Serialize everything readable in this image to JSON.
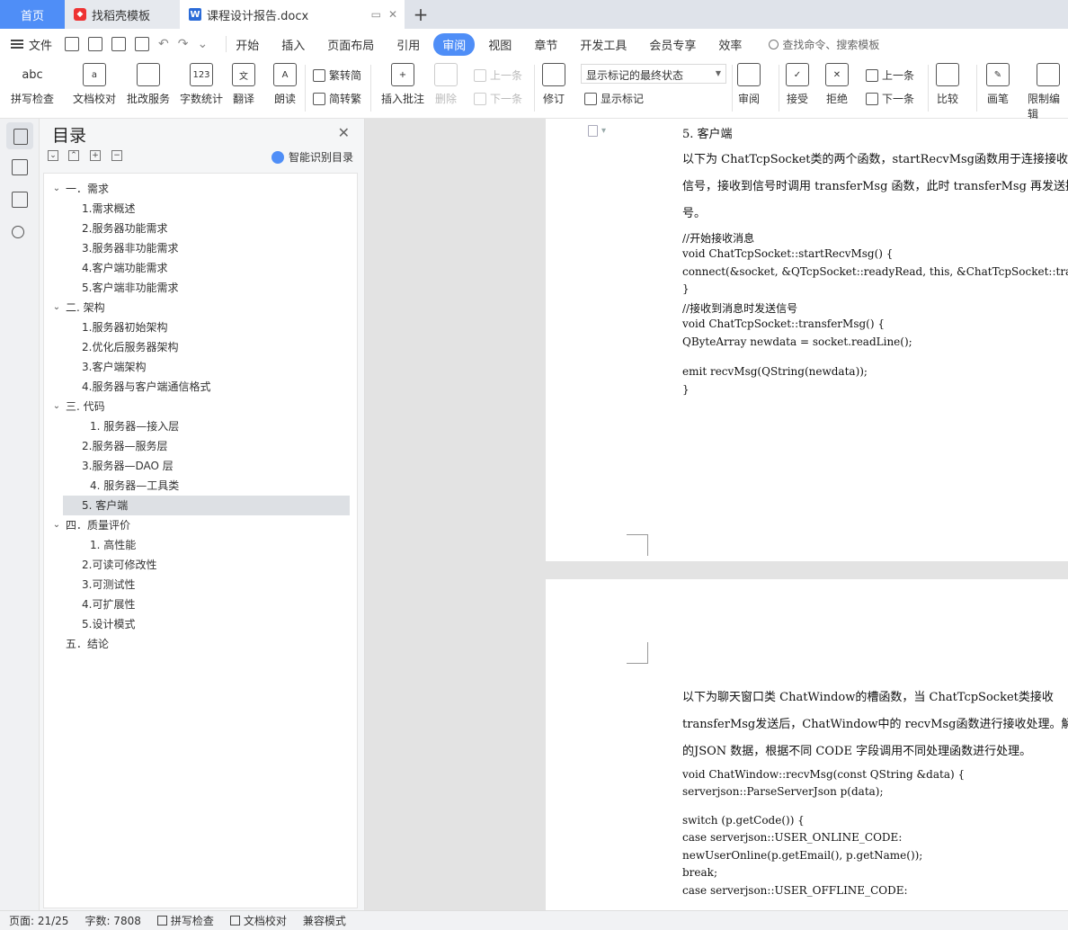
{
  "tabs": {
    "home": "首页",
    "template_tab": "找稻壳模板",
    "doc_tab": "课程设计报告.docx"
  },
  "menubar": {
    "file": "文件",
    "tabs": [
      "开始",
      "插入",
      "页面布局",
      "引用",
      "审阅",
      "视图",
      "章节",
      "开发工具",
      "会员专享",
      "效率"
    ],
    "active_tab": "审阅",
    "search_placeholder": "查找命令、搜索模板"
  },
  "ribbon": {
    "spell_check": "拼写检查",
    "doc_proof": "文档校对",
    "batch_service": "批改服务",
    "word_count": "字数统计",
    "translate": "翻译",
    "read_aloud": "朗读",
    "to_traditional": "繁转简",
    "to_simplified": "简转繁",
    "insert_comment": "插入批注",
    "delete": "删除",
    "prev": "上一条",
    "next": "下一条",
    "track_changes": "修订",
    "display_state": "显示标记的最终状态",
    "show_markup": "显示标记",
    "review": "审阅",
    "accept": "接受",
    "reject": "拒绝",
    "prev2": "上一条",
    "next2": "下一条",
    "compare": "比较",
    "pen": "画笔",
    "restrict_edit": "限制编辑"
  },
  "toc": {
    "title": "目录",
    "smart_label": "智能识别目录",
    "items": [
      {
        "text": "一．需求",
        "level": 1,
        "expanded": true
      },
      {
        "text": "1.需求概述",
        "level": 2
      },
      {
        "text": "2.服务器功能需求",
        "level": 2
      },
      {
        "text": "3.服务器非功能需求",
        "level": 2
      },
      {
        "text": "4.客户端功能需求",
        "level": 2
      },
      {
        "text": "5.客户端非功能需求",
        "level": 2
      },
      {
        "text": "二. 架构",
        "level": 1,
        "expanded": true
      },
      {
        "text": "1.服务器初始架构",
        "level": 2
      },
      {
        "text": "2.优化后服务器架构",
        "level": 2
      },
      {
        "text": "3.客户端架构",
        "level": 2
      },
      {
        "text": "4.服务器与客户端通信格式",
        "level": 2
      },
      {
        "text": "三. 代码",
        "level": 1,
        "expanded": true
      },
      {
        "text": "1. 服务器—接入层",
        "level": 3
      },
      {
        "text": "2.服务器—服务层",
        "level": 2
      },
      {
        "text": "3.服务器—DAO 层",
        "level": 2
      },
      {
        "text": "4. 服务器—工具类",
        "level": 3
      },
      {
        "text": "5. 客户端",
        "level": 2,
        "selected": true
      },
      {
        "text": "四．质量评价",
        "level": 1,
        "expanded": true
      },
      {
        "text": "1. 高性能",
        "level": 3
      },
      {
        "text": "2.可读可修改性",
        "level": 2
      },
      {
        "text": "3.可测试性",
        "level": 2
      },
      {
        "text": "4.可扩展性",
        "level": 2
      },
      {
        "text": "5.设计模式",
        "level": 2
      },
      {
        "text": "五．结论",
        "level": 1
      }
    ]
  },
  "page1": {
    "lines": [
      {
        "cls": "h",
        "text": "5. 客户端"
      },
      {
        "cls": "body",
        "text": "      以下为 ChatTcpSocket类的两个函数，startRecvMsg函数用于连接接收"
      },
      {
        "cls": "body",
        "text": "信号，接收到信号时调用 transferMsg 函数，此时 transferMsg 再发送接收"
      },
      {
        "cls": "body",
        "text": "号。"
      },
      {
        "cls": "code",
        "text": "//开始接收消息"
      },
      {
        "cls": "code",
        "text": "void ChatTcpSocket::startRecvMsg() {"
      },
      {
        "cls": "code",
        "text": "  connect(&socket, &QTcpSocket::readyRead, this, &ChatTcpSocket::transferMsg"
      },
      {
        "cls": "code",
        "text": "}"
      },
      {
        "cls": "code",
        "text": "//接收到消息时发送信号"
      },
      {
        "cls": "code",
        "text": "void ChatTcpSocket::transferMsg() {"
      },
      {
        "cls": "code",
        "text": "  QByteArray newdata = socket.readLine();"
      },
      {
        "cls": "code",
        "text": ""
      },
      {
        "cls": "code",
        "text": "  emit recvMsg(QString(newdata));"
      },
      {
        "cls": "code",
        "text": "}"
      }
    ]
  },
  "page2": {
    "lines": [
      {
        "cls": "body",
        "text": "      以下为聊天窗口类 ChatWindow的槽函数，当 ChatTcpSocket类接收"
      },
      {
        "cls": "body",
        "text": "transferMsg发送后，ChatWindow中的 recvMsg函数进行接收处理。解析"
      },
      {
        "cls": "body",
        "text": "的JSON 数据，根据不同 CODE 字段调用不同处理函数进行处理。"
      },
      {
        "cls": "code",
        "text": "void ChatWindow::recvMsg(const QString &data) {"
      },
      {
        "cls": "code",
        "text": "  serverjson::ParseServerJson p(data);"
      },
      {
        "cls": "code",
        "text": ""
      },
      {
        "cls": "code",
        "text": "  switch (p.getCode()) {"
      },
      {
        "cls": "code",
        "text": "  case serverjson::USER_ONLINE_CODE:"
      },
      {
        "cls": "code",
        "text": "    newUserOnline(p.getEmail(), p.getName());"
      },
      {
        "cls": "code",
        "text": "    break;"
      },
      {
        "cls": "code",
        "text": "  case serverjson::USER_OFFLINE_CODE:"
      }
    ]
  },
  "status": {
    "page": "页面: 21/25",
    "words": "字数: 7808",
    "spell": "拼写检查",
    "proof": "文档校对",
    "compat": "兼容模式"
  }
}
